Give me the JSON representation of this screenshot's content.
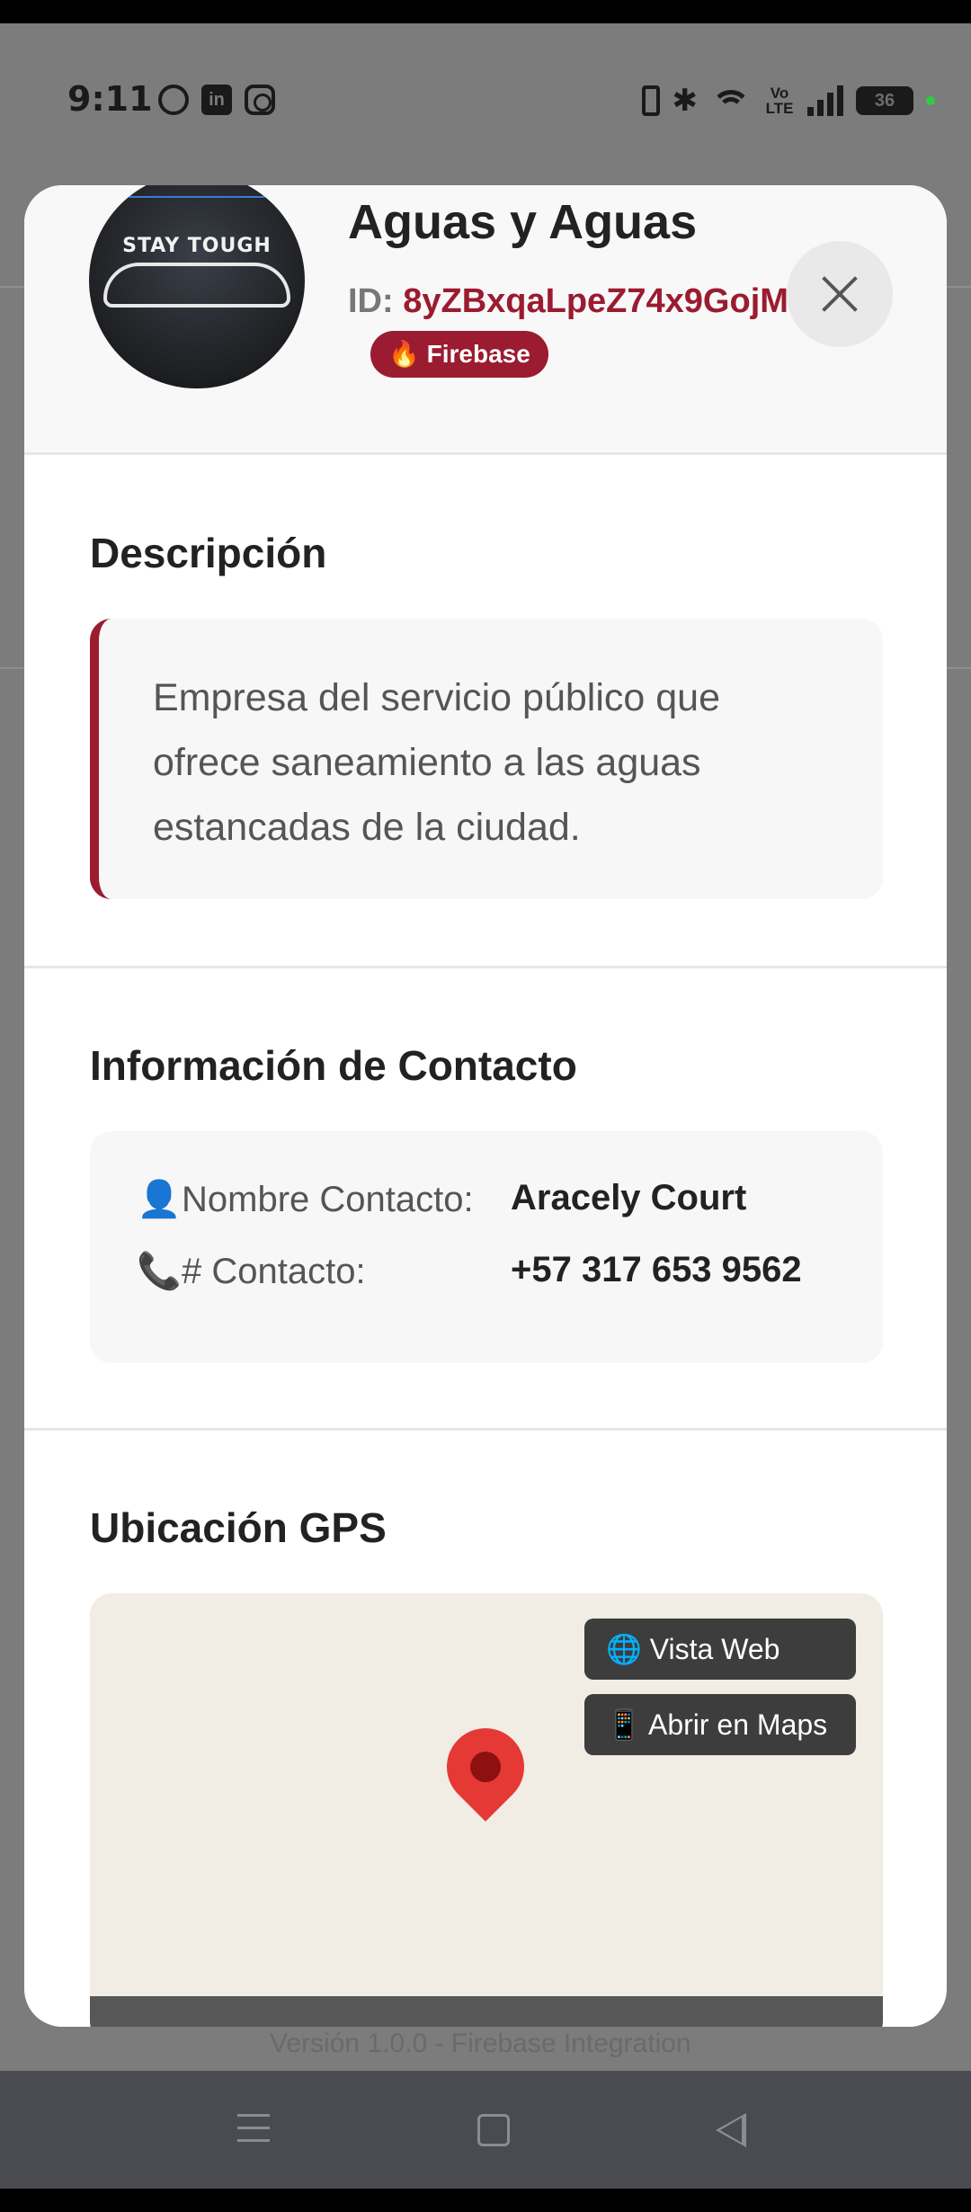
{
  "status_bar": {
    "time": "9:11",
    "battery": "36",
    "volte": "Vo LTE"
  },
  "modal": {
    "title": "Aguas y Aguas",
    "id_label": "ID: ",
    "id_value": "8yZBxqaLpeZ74x9GojM",
    "badge": "🔥 Firebase",
    "avatar_text": "STAY TOUGH",
    "description": {
      "title": "Descripción",
      "text": "Empresa del servicio público que ofrece saneamiento a las aguas estancadas de la ciudad."
    },
    "contact": {
      "title": "Información de Contacto",
      "name_icon": "👤",
      "name_label": "Nombre Contacto:",
      "name_value": "Aracely Court",
      "phone_icon": "📞",
      "phone_label": "# Contacto:",
      "phone_value": "+57 317 653 9562"
    },
    "location": {
      "title": "Ubicación GPS",
      "web_button": "🌐 Vista Web",
      "maps_button": "📱 Abrir en Maps"
    }
  },
  "background": {
    "footer_text": "Versión 1.0.0 - Firebase Integration"
  }
}
